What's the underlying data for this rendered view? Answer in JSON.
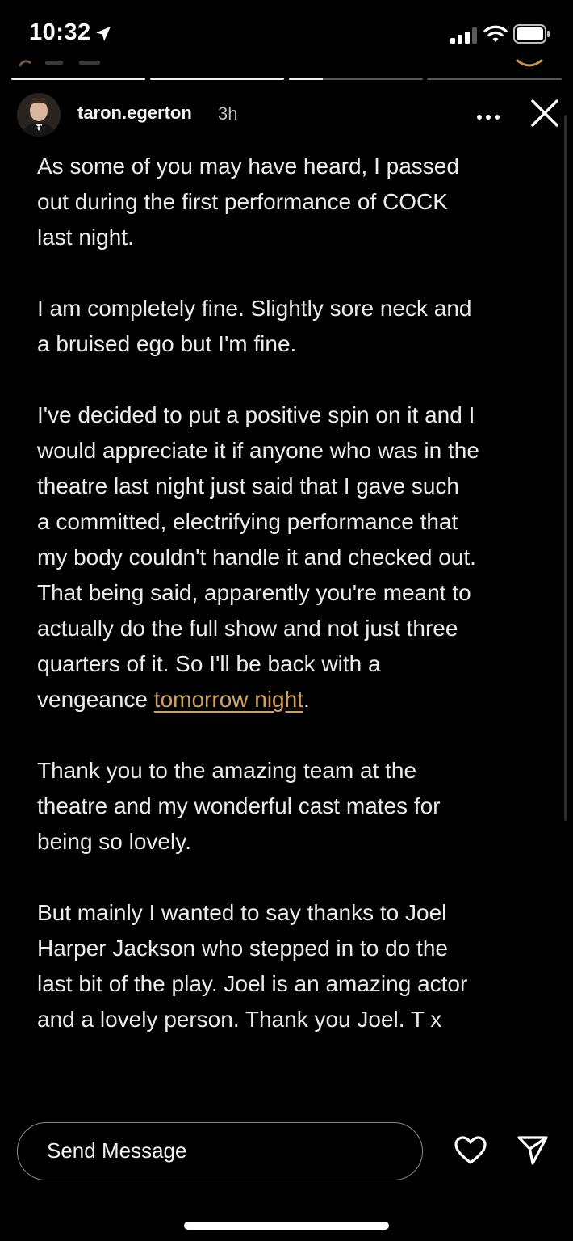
{
  "status_bar": {
    "time": "10:32",
    "icons": [
      "location-arrow-icon",
      "cellular-signal-icon",
      "wifi-icon",
      "battery-icon"
    ]
  },
  "story": {
    "segments_progress": [
      1.0,
      1.0,
      0.25,
      0.0
    ],
    "author": {
      "username": "taron.egerton",
      "time_ago": "3h"
    },
    "post": {
      "paragraphs": [
        "As some of you may have heard, I passed\nout during the first performance of COCK\nlast night.",
        "I am completely fine. Slightly sore neck and\na bruised ego but I'm fine.",
        "Thank you to the amazing team at the\ntheatre and my wonderful cast mates for\nbeing so lovely.",
        "But mainly I wanted to say thanks to Joel\nHarper Jackson who stepped in to do the\nlast bit of the play. Joel is an amazing actor\nand a lovely person. Thank you Joel. T x"
      ],
      "long_paragraph": {
        "text": "I've decided to put a positive spin on it and I\nwould appreciate it if anyone who was in the\ntheatre last night just said that I gave such\na committed, electrifying performance that\nmy body couldn't handle it and checked out.\nThat being said, apparently you're meant to\nactually do the full show and not just three\nquarters of it. So I'll be back with a\nvengeance ",
        "link_text": "tomorrow night",
        "after_link": "."
      }
    }
  },
  "footer": {
    "reply_placeholder": "Send Message"
  },
  "colors": {
    "background": "#000000",
    "text": "#ececec",
    "link": "#d1a25e"
  }
}
